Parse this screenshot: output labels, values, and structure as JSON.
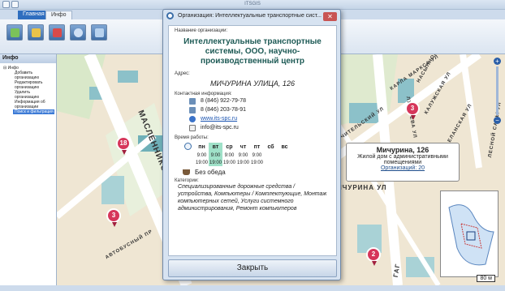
{
  "app": {
    "title": "ITSGIS"
  },
  "menu": {
    "tabs": [
      "Главная",
      "Инфо"
    ]
  },
  "left_panel": {
    "title": "Инфо",
    "root": "Инфо",
    "items": [
      "Добавить организацию",
      "Редактировать организацию",
      "Удалить организацию",
      "Информация об организации",
      "Поиск и фильтрация"
    ]
  },
  "map": {
    "streets": [
      "МАСЛЕННИКОВА ПРОСП",
      "ЛУКАЧЕВА УЛ",
      "КАРЛА МАРКСА УЛ",
      "КАЛУЖСКАЯ УЛ",
      "НАСЫПНОЙ ТУП",
      "ЧИТЕЛЬСКИЙ УЛ",
      "ЕЛАНСКАЯ УЛ",
      "ИЧУРИНА УЛ",
      "АВТОБУСНЫЙ ПР",
      "ЛЕСНОЙ САДЫ УЛ",
      "ГАГ"
    ],
    "markers": [
      "18",
      "3",
      "3",
      "2"
    ],
    "callout": {
      "title": "Мичурина, 126",
      "subtitle": "Жилой дом с административными помещениями",
      "link": "Организаций: 20"
    },
    "zoom_in": "+",
    "zoom_out": "−",
    "scale": "80 м"
  },
  "dialog": {
    "title": "Организация: Интеллектуальные транспортные сист...",
    "close": "✕",
    "name_label": "Название организации:",
    "name": "Интеллектуальные транспортные системы, ООО, научно-производственный центр",
    "address_label": "Адрес:",
    "address": "МИЧУРИНА УЛИЦА, 126",
    "contacts_label": "Контактная информация:",
    "contacts": [
      "8 (846) 922-79-78",
      "8 (846) 203-78-91",
      "www.its-spc.ru",
      "info@its-spc.ru"
    ],
    "hours_label": "Время работы:",
    "days": [
      "пн",
      "вт",
      "ср",
      "чт",
      "пт",
      "сб",
      "вс"
    ],
    "open": [
      "9:00",
      "9:00",
      "9:00",
      "9:00",
      "9:00",
      "",
      ""
    ],
    "close_times": [
      "19:00",
      "19:00",
      "19:00",
      "19:00",
      "19:00",
      "",
      ""
    ],
    "lunch": "Без обеда",
    "categories_label": "Категории:",
    "categories": "Специализированные дорожные средства / устройства, Компьютеры / Комплектующие, Монтаж компьютерных сетей, Услуги системного администрирования, Ремонт компьютеров",
    "close_button": "Закрыть"
  },
  "colors": {
    "accent": "#2f6ebf",
    "today": "#9fe1c8",
    "marker": "#d6365a",
    "org_name": "#1d5a55"
  }
}
